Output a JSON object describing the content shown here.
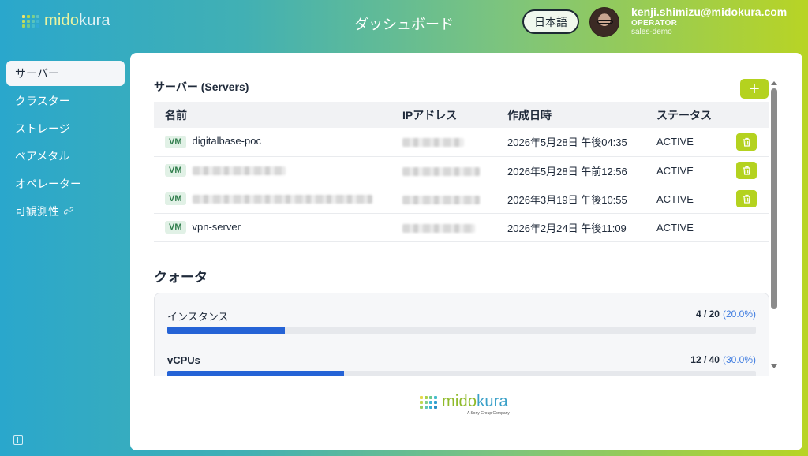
{
  "header": {
    "logo": {
      "mid": "mido",
      "end": "kura"
    },
    "title": "ダッシュボード",
    "language_button": "日本語",
    "user": {
      "email": "kenji.shimizu@midokura.com",
      "role": "OPERATOR",
      "tenant": "sales-demo"
    }
  },
  "sidebar": {
    "items": [
      {
        "label": "サーバー",
        "active": true
      },
      {
        "label": "クラスター",
        "active": false
      },
      {
        "label": "ストレージ",
        "active": false
      },
      {
        "label": "ベアメタル",
        "active": false
      },
      {
        "label": "オペレーター",
        "active": false
      },
      {
        "label": "可観測性",
        "active": false,
        "icon": "link-icon"
      }
    ]
  },
  "servers": {
    "title": "サーバー (Servers)",
    "add_label": "+",
    "columns": [
      "名前",
      "IPアドレス",
      "作成日時",
      "ステータス"
    ],
    "rows": [
      {
        "badge": "VM",
        "name": "digitalbase-poc",
        "created": "2026年5月28日 午後04:35",
        "status": "ACTIVE",
        "deletable": true
      },
      {
        "badge": "VM",
        "name": "",
        "created": "2026年5月28日 午前12:56",
        "status": "ACTIVE",
        "deletable": true
      },
      {
        "badge": "VM",
        "name": "",
        "created": "2026年3月19日 午後10:55",
        "status": "ACTIVE",
        "deletable": true
      },
      {
        "badge": "VM",
        "name": "vpn-server",
        "created": "2026年2月24日 午後11:09",
        "status": "ACTIVE",
        "deletable": false
      }
    ]
  },
  "quota": {
    "title": "クォータ",
    "items": [
      {
        "label": "インスタンス",
        "used": "4 / 20",
        "percent": "(20.0%)",
        "fraction": 0.2
      },
      {
        "label": "vCPUs",
        "used": "12 / 40",
        "percent": "(30.0%)",
        "fraction": 0.3
      }
    ]
  },
  "footer": {
    "logo_mid": "mido",
    "logo_end": "kura",
    "tagline": "A Sony Group Company"
  },
  "colors": {
    "accent": "#b4d21f",
    "bar": "#2563d6",
    "badge_bg": "#e1f1e6",
    "badge_text": "#2f7d4b"
  }
}
